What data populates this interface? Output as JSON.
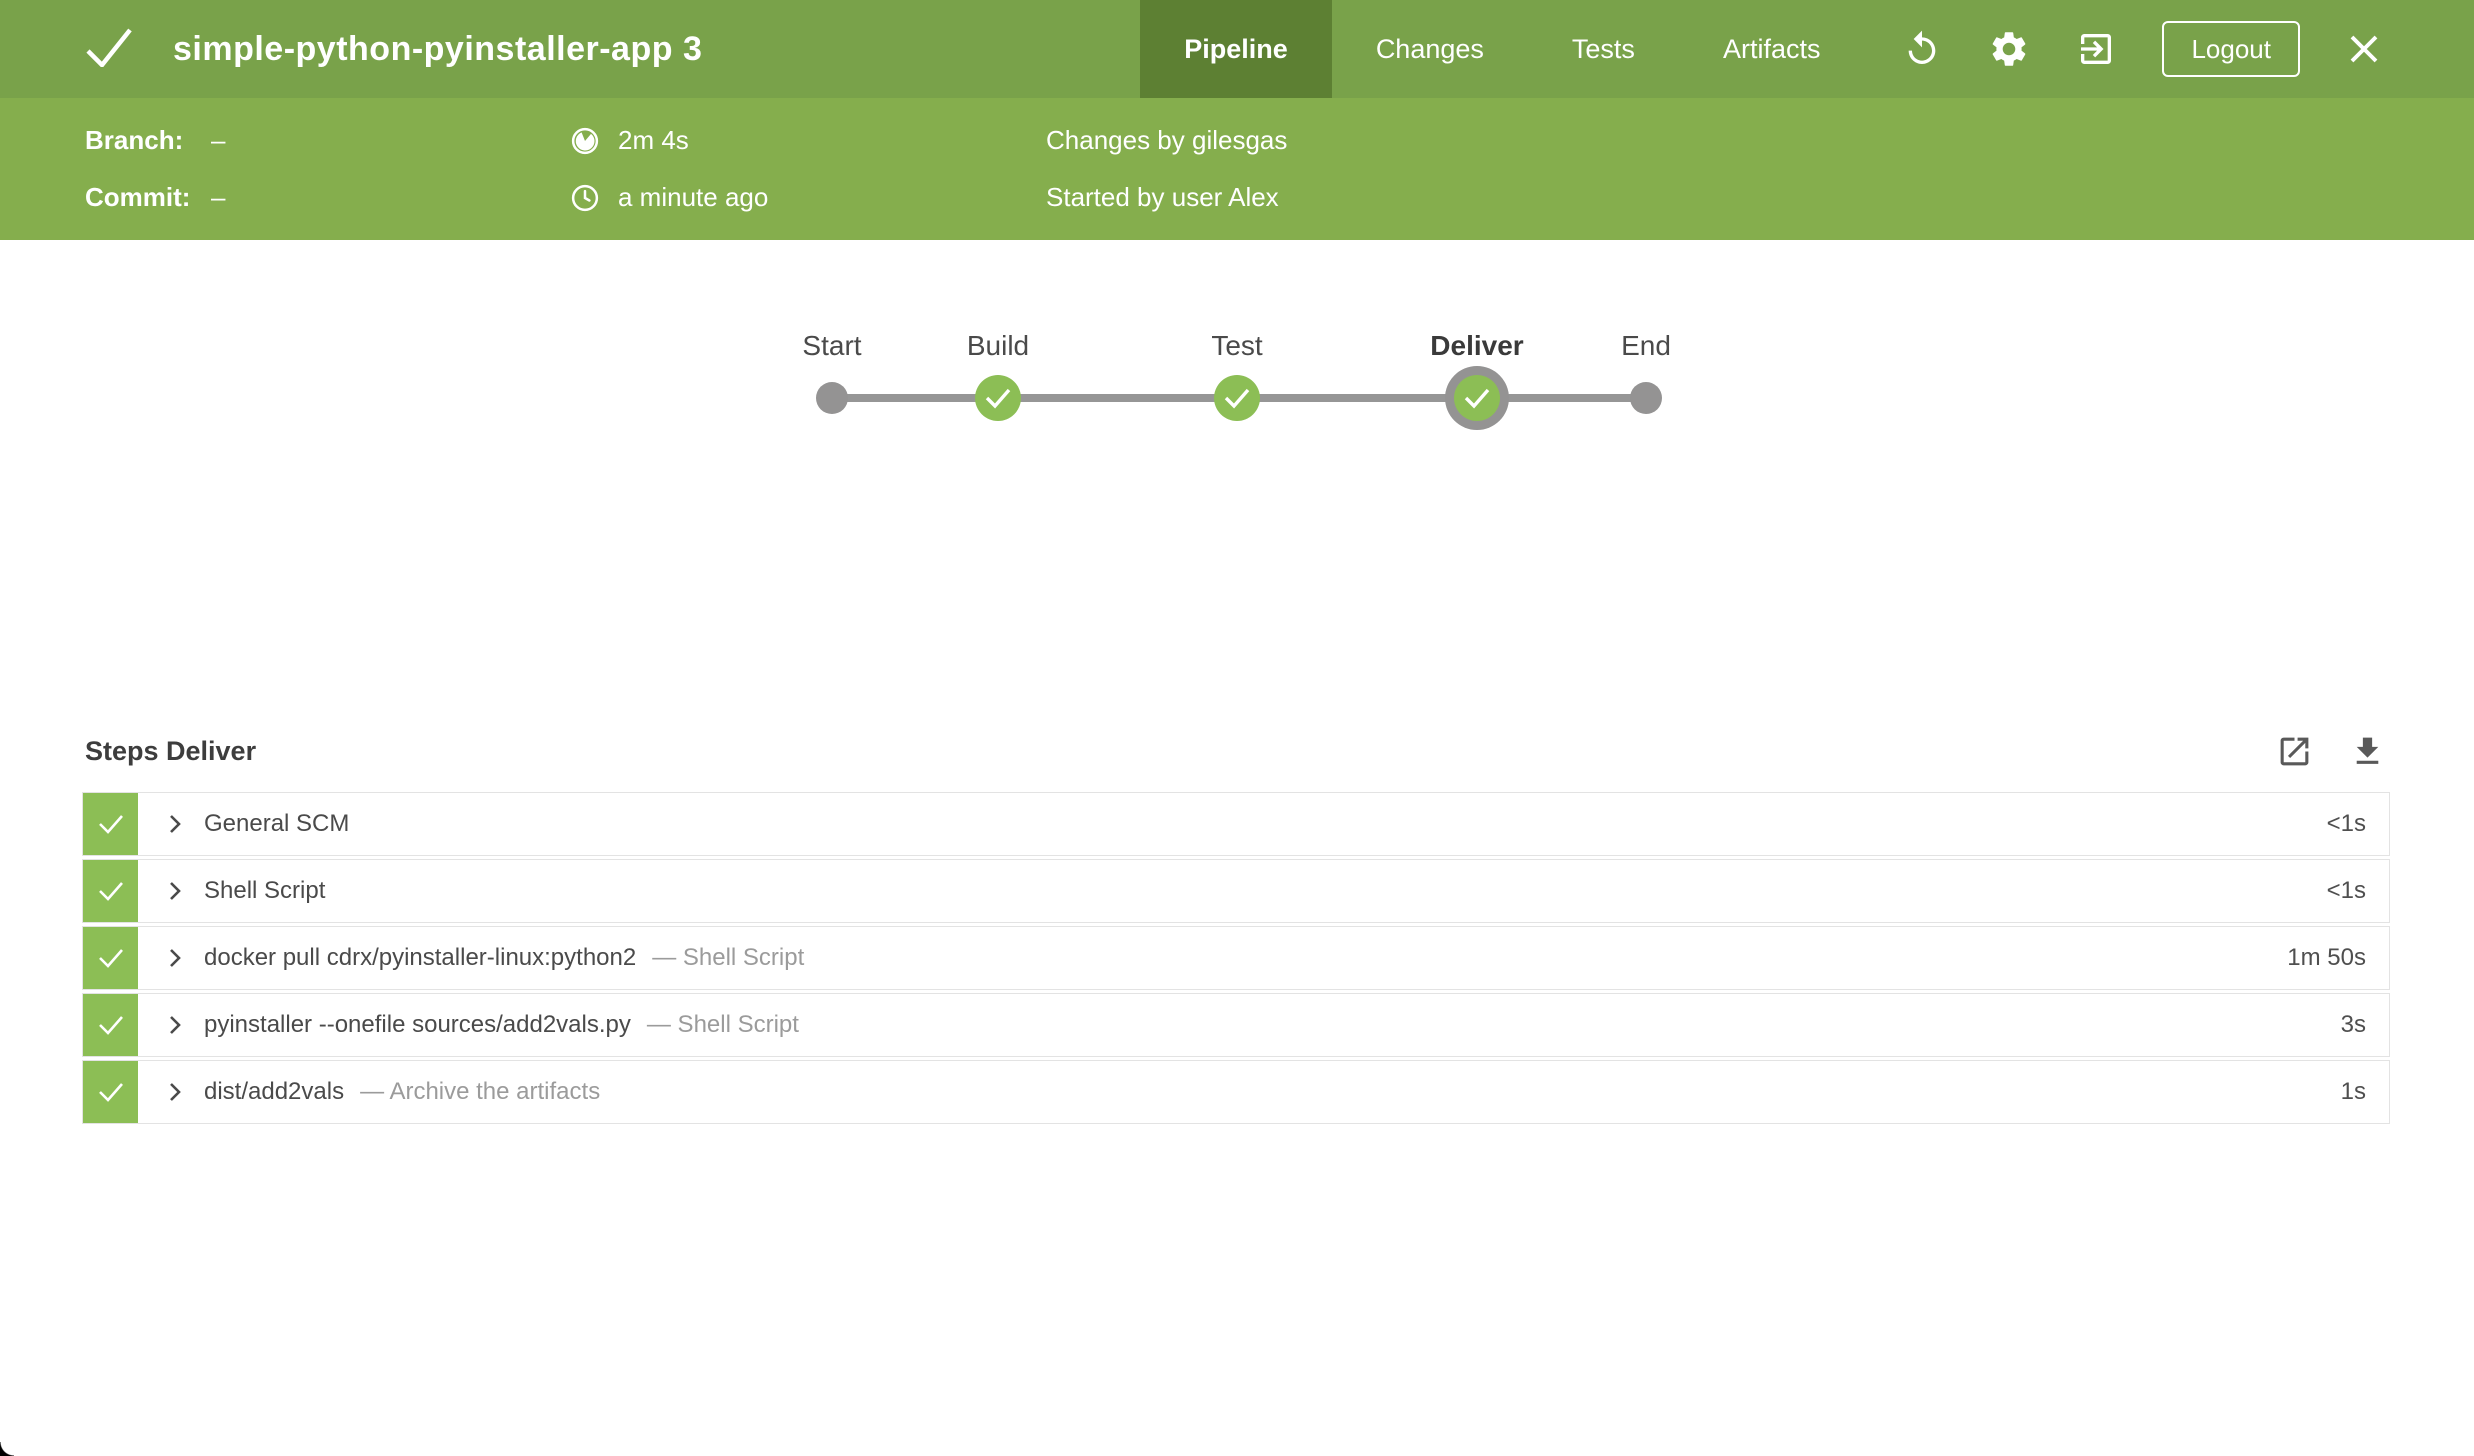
{
  "colors": {
    "header-bg": "#79a24a",
    "header-tab-active": "#5d8033",
    "subheader-bg": "#85ae4d",
    "success-green": "#8cbe55",
    "node-gray": "#949393",
    "line-gray": "#969696",
    "text-dark": "#4a4a4a",
    "text-secondary": "#9b9b9b",
    "row-border": "#e3e3e3",
    "icon-gray": "#595959"
  },
  "header": {
    "title": "simple-python-pyinstaller-app 3",
    "status": "success",
    "tabs": [
      {
        "label": "Pipeline",
        "active": true
      },
      {
        "label": "Changes",
        "active": false
      },
      {
        "label": "Tests",
        "active": false
      },
      {
        "label": "Artifacts",
        "active": false
      }
    ],
    "logout_label": "Logout",
    "icons": [
      "check-icon",
      "replay-icon",
      "settings-gear-icon",
      "exit-icon",
      "close-icon"
    ]
  },
  "run_info": {
    "branch_label": "Branch:",
    "branch_value": "–",
    "commit_label": "Commit:",
    "commit_value": "–",
    "duration": "2m 4s",
    "time_ago": "a minute ago",
    "changes": "Changes by gilesgas",
    "started_by": "Started by user Alex",
    "icons": [
      "duration-pie-icon",
      "clock-icon"
    ]
  },
  "pipeline": {
    "stages": [
      {
        "name": "Start",
        "terminal": true,
        "selected": false,
        "status": ""
      },
      {
        "name": "Build",
        "terminal": false,
        "selected": false,
        "status": "success"
      },
      {
        "name": "Test",
        "terminal": false,
        "selected": false,
        "status": "success"
      },
      {
        "name": "Deliver",
        "terminal": false,
        "selected": true,
        "status": "success"
      },
      {
        "name": "End",
        "terminal": true,
        "selected": false,
        "status": ""
      }
    ]
  },
  "steps": {
    "heading": "Steps Deliver",
    "header_icons": [
      "open-in-new-icon",
      "download-icon"
    ],
    "rows": [
      {
        "name": "General SCM",
        "detail": "",
        "duration": "<1s",
        "status": "success"
      },
      {
        "name": "Shell Script",
        "detail": "",
        "duration": "<1s",
        "status": "success"
      },
      {
        "name": "docker pull cdrx/pyinstaller-linux:python2",
        "detail": "— Shell Script",
        "duration": "1m 50s",
        "status": "success"
      },
      {
        "name": "pyinstaller --onefile sources/add2vals.py",
        "detail": "— Shell Script",
        "duration": "3s",
        "status": "success"
      },
      {
        "name": "dist/add2vals",
        "detail": "— Archive the artifacts",
        "duration": "1s",
        "status": "success"
      }
    ]
  }
}
